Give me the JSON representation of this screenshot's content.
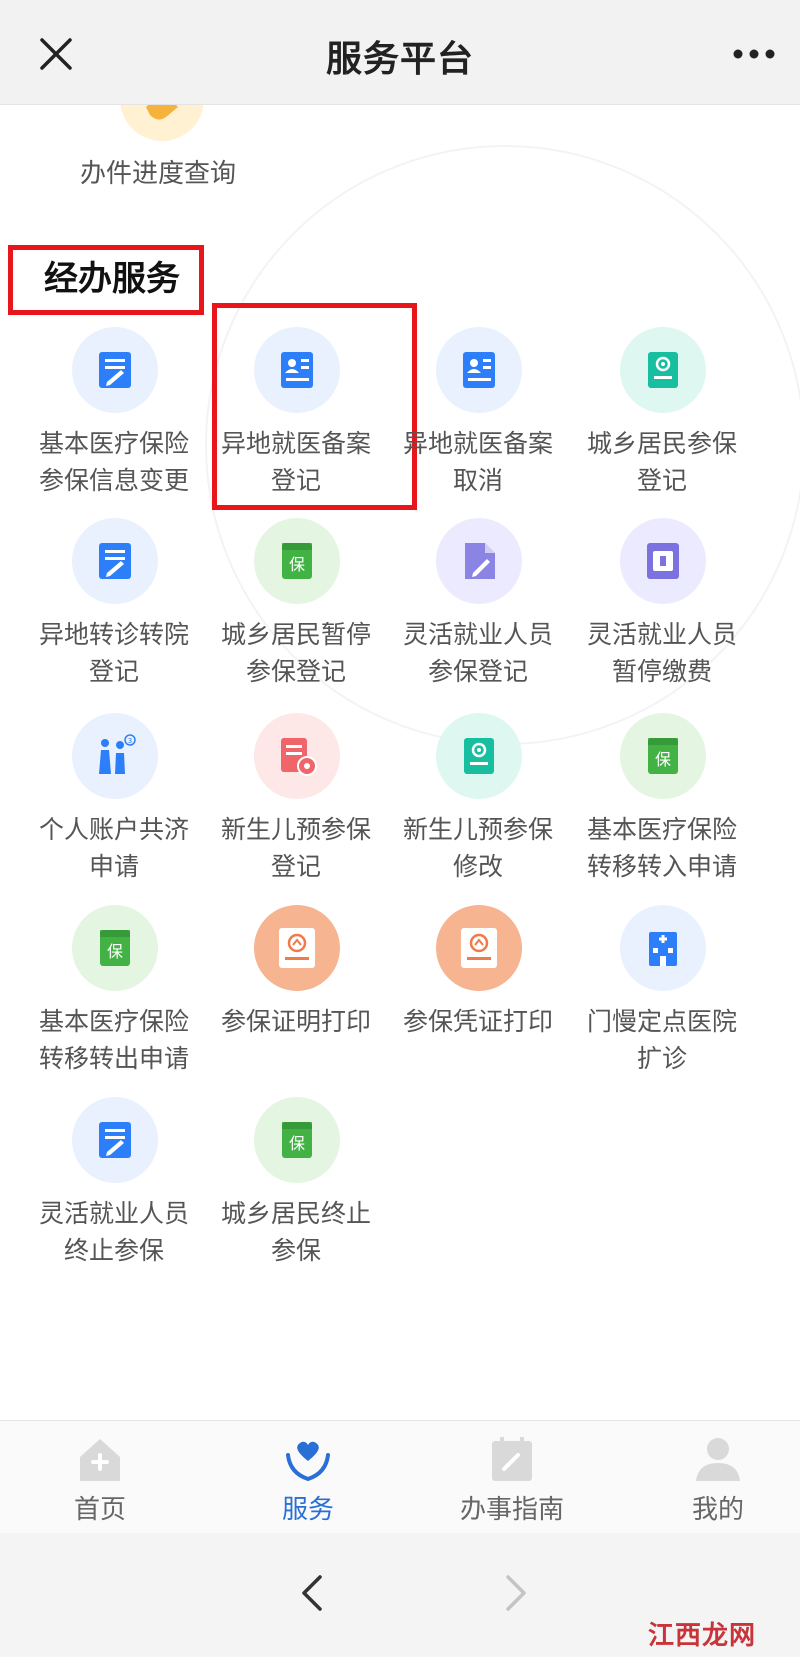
{
  "header": {
    "title": "服务平台",
    "close_icon": "close-icon",
    "more_icon": "more-dots-icon"
  },
  "previous_section": {
    "item_label": "办件进度查询",
    "icon": "handshake-icon"
  },
  "section": {
    "title": "经办服务",
    "tiles": [
      {
        "line1": "基本医疗保险",
        "line2": "参保信息变更",
        "icon": "form-edit-icon",
        "color": "#2d7ff9"
      },
      {
        "line1": "异地就医备案",
        "line2": "登记",
        "icon": "id-card-icon",
        "color": "#2d7ff9",
        "highlighted": true
      },
      {
        "line1": "异地就医备案",
        "line2": "取消",
        "icon": "id-card-icon",
        "color": "#2d7ff9"
      },
      {
        "line1": "城乡居民参保",
        "line2": "登记",
        "icon": "book-register-icon",
        "color": "#17bfa0"
      },
      {
        "line1": "异地转诊转院",
        "line2": "登记",
        "icon": "form-edit-icon",
        "color": "#2d7ff9"
      },
      {
        "line1": "城乡居民暂停",
        "line2": "参保登记",
        "icon": "insurance-book-icon",
        "color": "#43b245"
      },
      {
        "line1": "灵活就业人员",
        "line2": "参保登记",
        "icon": "document-sign-icon",
        "color": "#7b72e0"
      },
      {
        "line1": "灵活就业人员",
        "line2": "暂停缴费",
        "icon": "pause-card-icon",
        "color": "#7b72e0"
      },
      {
        "line1": "个人账户共济",
        "line2": "申请",
        "icon": "family-share-icon",
        "color": "#2d7ff9"
      },
      {
        "line1": "新生儿预参保",
        "line2": "登记",
        "icon": "newborn-register-icon",
        "color": "#f0656a"
      },
      {
        "line1": "新生儿预参保",
        "line2": "修改",
        "icon": "book-register-icon",
        "color": "#17bfa0"
      },
      {
        "line1": "基本医疗保险",
        "line2": "转移转入申请",
        "icon": "insurance-book-icon",
        "color": "#43b245"
      },
      {
        "line1": "基本医疗保险",
        "line2": "转移转出申请",
        "icon": "insurance-book-icon",
        "color": "#43b245"
      },
      {
        "line1": "参保证明打印",
        "line2": "",
        "icon": "certificate-print-icon",
        "color": "#f07a4a"
      },
      {
        "line1": "参保凭证打印",
        "line2": "",
        "icon": "certificate-print-icon",
        "color": "#f07a4a"
      },
      {
        "line1": "门慢定点医院",
        "line2": "扩诊",
        "icon": "hospital-icon",
        "color": "#2d7ff9"
      },
      {
        "line1": "灵活就业人员",
        "line2": "终止参保",
        "icon": "form-edit-icon",
        "color": "#2d7ff9"
      },
      {
        "line1": "城乡居民终止",
        "line2": "参保",
        "icon": "insurance-book-icon",
        "color": "#43b245"
      }
    ]
  },
  "tabbar": {
    "tabs": [
      {
        "label": "首页",
        "icon": "home-icon",
        "active": false
      },
      {
        "label": "服务",
        "icon": "heart-hands-icon",
        "active": true
      },
      {
        "label": "办事指南",
        "icon": "guide-calendar-icon",
        "active": false
      },
      {
        "label": "我的",
        "icon": "user-icon",
        "active": false
      }
    ]
  },
  "browser_bar": {
    "back_icon": "chevron-left-icon",
    "forward_icon": "chevron-right-icon"
  },
  "watermark": {
    "text": "江西龙网"
  }
}
